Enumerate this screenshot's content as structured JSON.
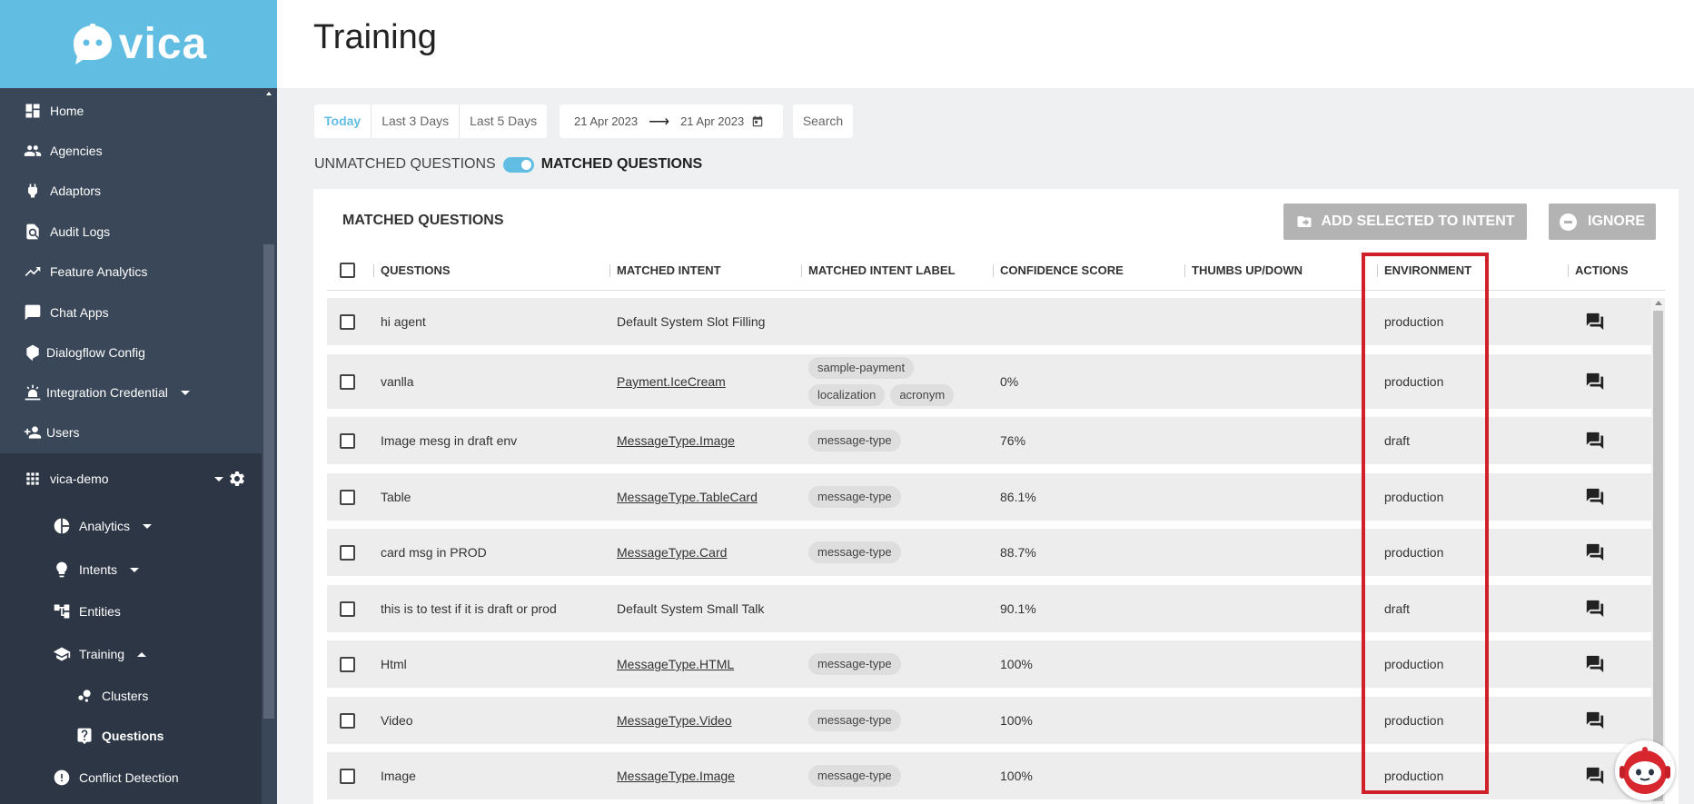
{
  "brand": {
    "name": "vica"
  },
  "sidebar": {
    "items": [
      {
        "label": "Home",
        "icon": "dashboard-icon"
      },
      {
        "label": "Agencies",
        "icon": "people-icon"
      },
      {
        "label": "Adaptors",
        "icon": "plug-icon"
      },
      {
        "label": "Audit Logs",
        "icon": "document-search-icon"
      },
      {
        "label": "Feature Analytics",
        "icon": "trending-up-icon"
      },
      {
        "label": "Chat Apps",
        "icon": "chat-bubble-icon"
      },
      {
        "label": "Dialogflow Config",
        "icon": "dialogflow-icon"
      },
      {
        "label": "Integration Credential",
        "icon": "sunrise-icon"
      },
      {
        "label": "Users",
        "icon": "person-add-icon"
      }
    ],
    "project": {
      "label": "vica-demo"
    },
    "sub_items": [
      {
        "label": "Analytics"
      },
      {
        "label": "Intents"
      },
      {
        "label": "Entities"
      },
      {
        "label": "Training"
      },
      {
        "label": "Clusters"
      },
      {
        "label": "Questions"
      },
      {
        "label": "Conflict Detection"
      }
    ]
  },
  "header": {
    "title": "Training"
  },
  "filters": {
    "ranges": [
      "Today",
      "Last 3 Days",
      "Last 5 Days"
    ],
    "active_range": "Today",
    "date_from": "21 Apr 2023",
    "date_to": "21 Apr 2023",
    "search_label": "Search"
  },
  "toggle": {
    "left_label": "UNMATCHED QUESTIONS",
    "right_label": "MATCHED QUESTIONS",
    "state": "matched"
  },
  "card": {
    "title": "MATCHED QUESTIONS",
    "add_button": "ADD SELECTED TO INTENT",
    "ignore_button": "IGNORE"
  },
  "table": {
    "columns": [
      "QUESTIONS",
      "MATCHED INTENT",
      "MATCHED INTENT LABEL",
      "CONFIDENCE SCORE",
      "THUMBS UP/DOWN",
      "ENVIRONMENT",
      "ACTIONS"
    ],
    "rows": [
      {
        "question": "hi agent",
        "intent": "Default System Slot Filling",
        "intent_link": false,
        "labels": [],
        "confidence": "",
        "thumbs": "",
        "environment": "production"
      },
      {
        "question": "vanlla",
        "intent": "Payment.IceCream",
        "intent_link": true,
        "labels": [
          "sample-payment",
          "localization",
          "acronym"
        ],
        "confidence": "0%",
        "thumbs": "",
        "environment": "production"
      },
      {
        "question": "Image mesg in draft env",
        "intent": "MessageType.Image",
        "intent_link": true,
        "labels": [
          "message-type"
        ],
        "confidence": "76%",
        "thumbs": "",
        "environment": "draft"
      },
      {
        "question": "Table",
        "intent": "MessageType.TableCard",
        "intent_link": true,
        "labels": [
          "message-type"
        ],
        "confidence": "86.1%",
        "thumbs": "",
        "environment": "production"
      },
      {
        "question": "card msg in PROD",
        "intent": "MessageType.Card",
        "intent_link": true,
        "labels": [
          "message-type"
        ],
        "confidence": "88.7%",
        "thumbs": "",
        "environment": "production"
      },
      {
        "question": "this is to test if it is draft or prod",
        "intent": "Default System Small Talk",
        "intent_link": false,
        "labels": [],
        "confidence": "90.1%",
        "thumbs": "",
        "environment": "draft"
      },
      {
        "question": "Html",
        "intent": "MessageType.HTML",
        "intent_link": true,
        "labels": [
          "message-type"
        ],
        "confidence": "100%",
        "thumbs": "",
        "environment": "production"
      },
      {
        "question": "Video",
        "intent": "MessageType.Video",
        "intent_link": true,
        "labels": [
          "message-type"
        ],
        "confidence": "100%",
        "thumbs": "",
        "environment": "production"
      },
      {
        "question": "Image",
        "intent": "MessageType.Image",
        "intent_link": true,
        "labels": [
          "message-type"
        ],
        "confidence": "100%",
        "thumbs": "",
        "environment": "production"
      }
    ]
  },
  "colors": {
    "brand": "#62bde3",
    "sidebar_upper": "#3a4758",
    "sidebar_lower": "#2c3645",
    "highlight": "#d0202a",
    "button_disabled": "#b3b3b3"
  }
}
